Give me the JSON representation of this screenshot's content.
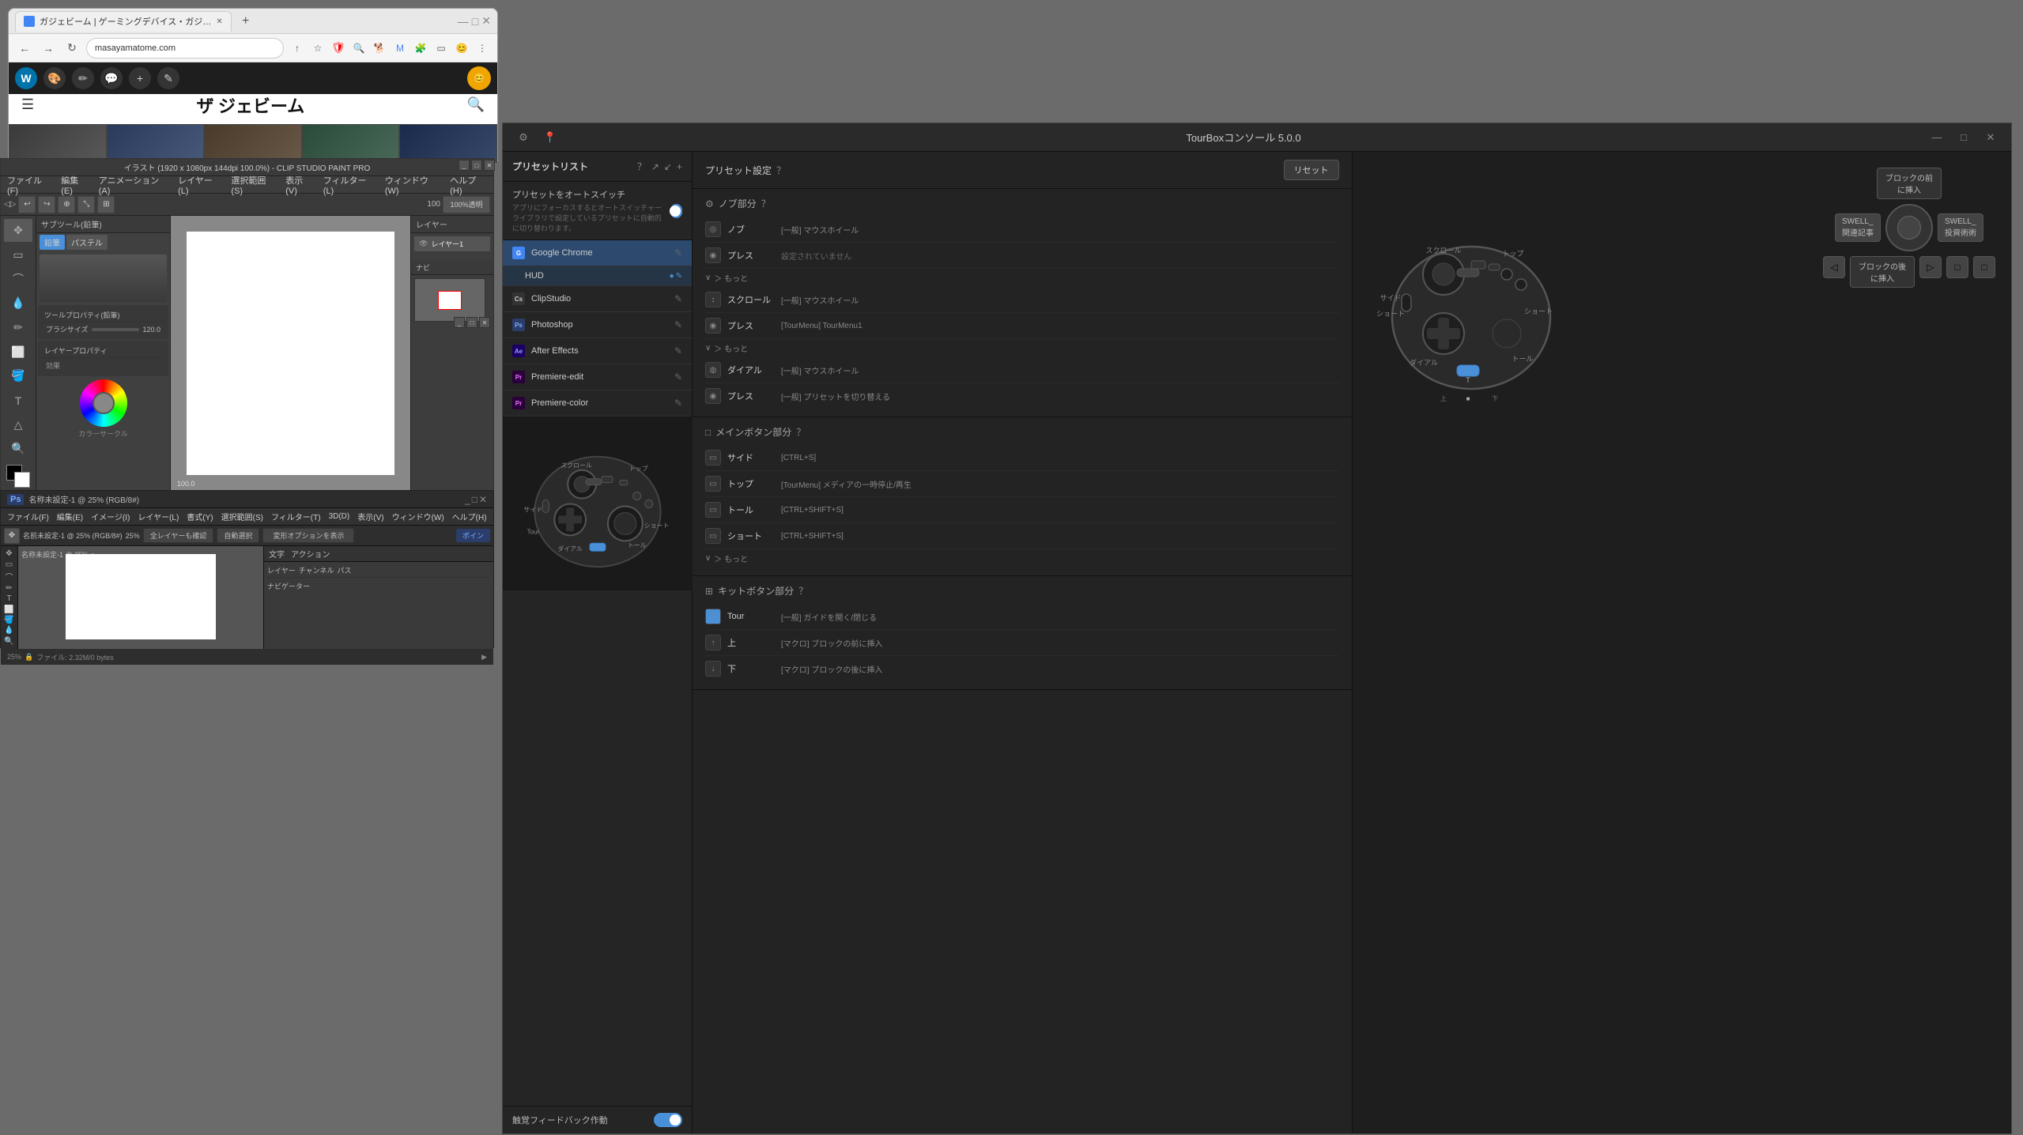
{
  "browser": {
    "tab_title": "ガジェビーム | ゲーミングデバイス・ガジ…",
    "url": "masayamatome.com",
    "title": "ガジェビーム",
    "site_logo": "ザ ジェビーム",
    "new_tab_label": "+",
    "icons": {
      "back": "←",
      "forward": "→",
      "refresh": "↻",
      "bookmark": "☆",
      "star": "★",
      "menu": "⋮",
      "search": "🔍",
      "hamburger": "☰",
      "wp": "W",
      "brush": "🖌",
      "pen": "✏",
      "comment": "💬",
      "plus": "+",
      "edit": "✎"
    }
  },
  "csp": {
    "title": "イラスト (1920 x 1080px 144dpi 100.0%) - CLIP STUDIO PAINT PRO",
    "menus": [
      "ファイル(F)",
      "編集(E)",
      "アニメーション(A)",
      "レイヤー(L)",
      "選択範囲(S)",
      "表示(V)",
      "フィルター(L)",
      "ウィンドウ(W)",
      "ヘルプ(H)"
    ],
    "sub_panel_title": "サブツール(鉛筆)",
    "brush_tabs": [
      "鉛筆",
      "パステル"
    ],
    "brush_size_label": "ブラシサイズ",
    "brush_size_value": "120.0",
    "layer_title": "レイヤー",
    "canvas_label": "イラスト",
    "layer_names": [
      "レイヤー1"
    ],
    "opacity": "100%",
    "zoom": "100.0",
    "color_circle_label": "カラーサークル",
    "tool_property_label": "ツールプロパティ(鉛筆)",
    "layer_property_label": "レイヤープロパティ",
    "effect_label": "効果",
    "navi_label": "ナビ"
  },
  "photoshop": {
    "title": "名称未設定-1 @ 25% (RGB/8#)",
    "menus": [
      "ファイル(F)",
      "編集(E)",
      "イメージ(I)",
      "レイヤー(L)",
      "書式(Y)",
      "選択範囲(S)",
      "フィルター(T)",
      "3D(D)",
      "表示(V)",
      "ウィンドウ(W)",
      "ヘルプ(H)"
    ],
    "icon": "Ps",
    "zoom_level": "25%",
    "file_size": "ファイル: 2.32M/0 bytes",
    "panels": [
      "文字",
      "アクション"
    ],
    "layer_panel": "レイヤー",
    "channel_panel": "チャンネル",
    "path_panel": "パス",
    "navi_panel": "ナビゲーター",
    "auto_select": "全レイヤーも確認",
    "auto_transform": "自動選択",
    "show_transform": "変形オプションを表示"
  },
  "tourbox": {
    "title": "TourBoxコンソール 5.0.0",
    "reset_btn": "リセット",
    "preset_list_header": "プリセットリスト",
    "preset_settings_header": "プリセット設定",
    "auto_switch_label": "プリセットをオートスイッチ",
    "auto_switch_desc": "アプリにフォーカスするとオートスイッチャーライブラリで設定しているプリセットに自動的に切り替わります。",
    "presets": [
      {
        "name": "Google Chrome",
        "icon": "🌐",
        "color": "#4285f4",
        "active": true,
        "has_hud": true
      },
      {
        "name": "ClipStudio",
        "icon": "✏",
        "color": "#333",
        "active": false
      },
      {
        "name": "Photoshop",
        "icon": "Ps",
        "color": "#2b3d6b",
        "active": false
      },
      {
        "name": "After Effects",
        "icon": "Ae",
        "color": "#9999ff",
        "active": false
      },
      {
        "name": "Premiere-edit",
        "icon": "Pr",
        "color": "#9999ff",
        "active": false
      },
      {
        "name": "Premiere-color",
        "icon": "Pr",
        "color": "#ea77ff",
        "active": false
      }
    ],
    "hud_label": "HUD",
    "sections": {
      "knob": {
        "label": "ノブ部分",
        "controls": [
          {
            "name": "ノブ",
            "knob": {
              "label": "[一般] マウスホイール"
            },
            "press": {
              "label": "設定されていません"
            }
          },
          {
            "name": "スクロール",
            "label": "[一般] マウスホイール"
          },
          {
            "name": "プレス",
            "label": "[TourMenu] TourMenu1"
          },
          {
            "name": "ダイアル",
            "label": "[一般] マウスホイール"
          },
          {
            "name": "プレス (dial)",
            "label": "[一般] プリセットを切り替える"
          }
        ]
      },
      "main": {
        "label": "メインボタン部分",
        "controls": [
          {
            "name": "サイド",
            "label": "[CTRL+S]"
          },
          {
            "name": "トップ",
            "label": "[TourMenu] メディアの一時停止/再生"
          },
          {
            "name": "トール",
            "label": "[CTRL+SHIFT+S]"
          },
          {
            "name": "ショート",
            "label": "[CTRL+SHIFT+S]"
          }
        ]
      },
      "kit": {
        "label": "キットボタン部分",
        "controls": [
          {
            "name": "Tour",
            "label": "[一般] ガイドを開く/閉じる"
          },
          {
            "name": "上",
            "label": "[マクロ] ブロックの前に挿入"
          },
          {
            "name": "下",
            "label": "[マクロ] ブロックの後に挿入"
          }
        ]
      }
    },
    "device_labels": {
      "scroll": "スクロール",
      "top": "トップ",
      "side": "サイド",
      "tour": "Tour",
      "dial": "ダイアル",
      "tall": "トール",
      "short": "ショート"
    },
    "feedback_label": "触覚フィードバック作動",
    "swell_labels": {
      "related_articles": "関連記事",
      "block_before": "ブロックの前に挿入",
      "block_after": "ブロックの後に挿入",
      "left": "SWELL_",
      "right": "SWELL_"
    },
    "more_label": "＞ もっと",
    "info_icon": "？"
  }
}
